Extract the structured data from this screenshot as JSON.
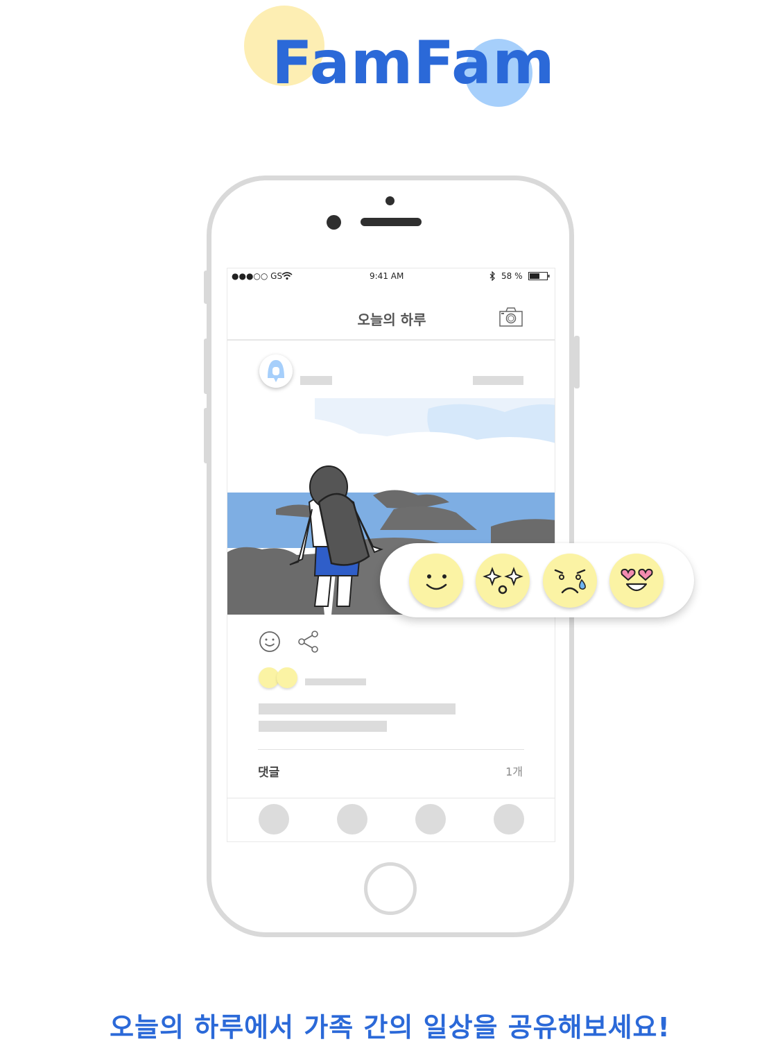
{
  "app": {
    "logo_text": "FamFam",
    "tagline": "오늘의 하루에서 가족 간의 일상을 공유해보세요!"
  },
  "status_bar": {
    "carrier": "●●●○○ GS",
    "time": "9:41 AM",
    "battery": "58 %"
  },
  "navbar": {
    "title": "오늘의 하루"
  },
  "post": {
    "comments_label": "댓글",
    "comments_count": "1개"
  },
  "reactions": {
    "items": [
      {
        "icon": "smile-emoji-icon"
      },
      {
        "icon": "sparkle-eyes-emoji-icon"
      },
      {
        "icon": "crying-emoji-icon"
      },
      {
        "icon": "heart-eyes-emoji-icon"
      }
    ]
  },
  "colors": {
    "brand_blue": "#2b69d8",
    "logo_yellow": "#fdeeb3",
    "logo_light_blue": "#a6cffb",
    "emoji_yellow": "#fbf3a4"
  }
}
